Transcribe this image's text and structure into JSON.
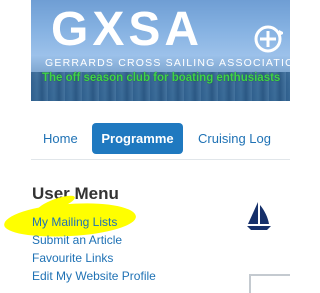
{
  "banner": {
    "logo_text": "GXSA",
    "club_name": "GERRARDS CROSS SAILING ASSOCIATION",
    "tagline": "The off season club for boating enthusiasts"
  },
  "nav": {
    "items": [
      {
        "label": "Home"
      },
      {
        "label": "Programme",
        "active": true
      },
      {
        "label": "Cruising Log"
      }
    ],
    "active_color": "#1f79c0",
    "link_color": "#1f72b5"
  },
  "user_menu": {
    "heading": "User Menu",
    "links": [
      {
        "label": "My Mailing Lists",
        "highlighted": true
      },
      {
        "label": "Submit an Article"
      },
      {
        "label": "Favourite Links"
      },
      {
        "label": "Edit My Website Profile"
      }
    ],
    "highlight_color": "#ffff00"
  },
  "icons": {
    "sail": "sailboat-icon",
    "flag": "flag-icon"
  }
}
